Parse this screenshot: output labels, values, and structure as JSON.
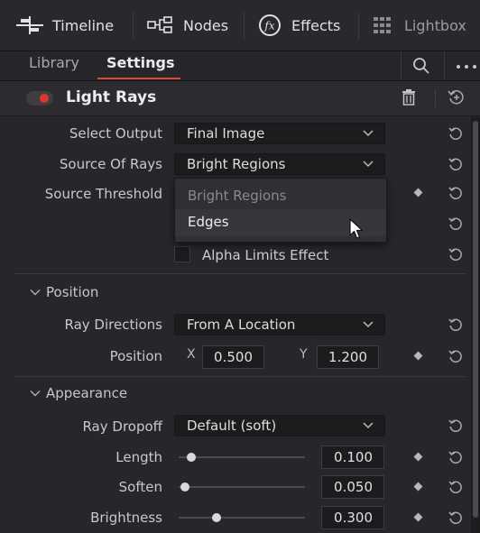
{
  "toolbar": {
    "timeline": "Timeline",
    "nodes": "Nodes",
    "effects": "Effects",
    "lightbox": "Lightbox"
  },
  "tabs": {
    "library": "Library",
    "settings": "Settings"
  },
  "effect": {
    "name": "Light Rays",
    "enabled": true,
    "toggle_color": "#e0362b"
  },
  "params": {
    "select_output": {
      "label": "Select Output",
      "value": "Final Image"
    },
    "source_of_rays": {
      "label": "Source Of Rays",
      "value": "Bright Regions"
    },
    "source_threshold": {
      "label": "Source Threshold"
    },
    "alpha_limits": {
      "label": "Alpha Limits Effect",
      "checked": false
    }
  },
  "menu": {
    "items": [
      "Bright Regions",
      "Edges"
    ],
    "hovered": "Edges"
  },
  "position_section": {
    "title": "Position",
    "ray_directions": {
      "label": "Ray Directions",
      "value": "From A Location"
    },
    "position": {
      "label": "Position",
      "x_label": "X",
      "x": "0.500",
      "y_label": "Y",
      "y": "1.200"
    }
  },
  "appearance_section": {
    "title": "Appearance",
    "ray_dropoff": {
      "label": "Ray Dropoff",
      "value": "Default (soft)"
    },
    "length": {
      "label": "Length",
      "value": "0.100",
      "level": 0.1
    },
    "soften": {
      "label": "Soften",
      "value": "0.050",
      "level": 0.05
    },
    "brightness": {
      "label": "Brightness",
      "value": "0.300",
      "level": 0.3
    }
  },
  "colors": {
    "accent": "#d94a3d"
  }
}
